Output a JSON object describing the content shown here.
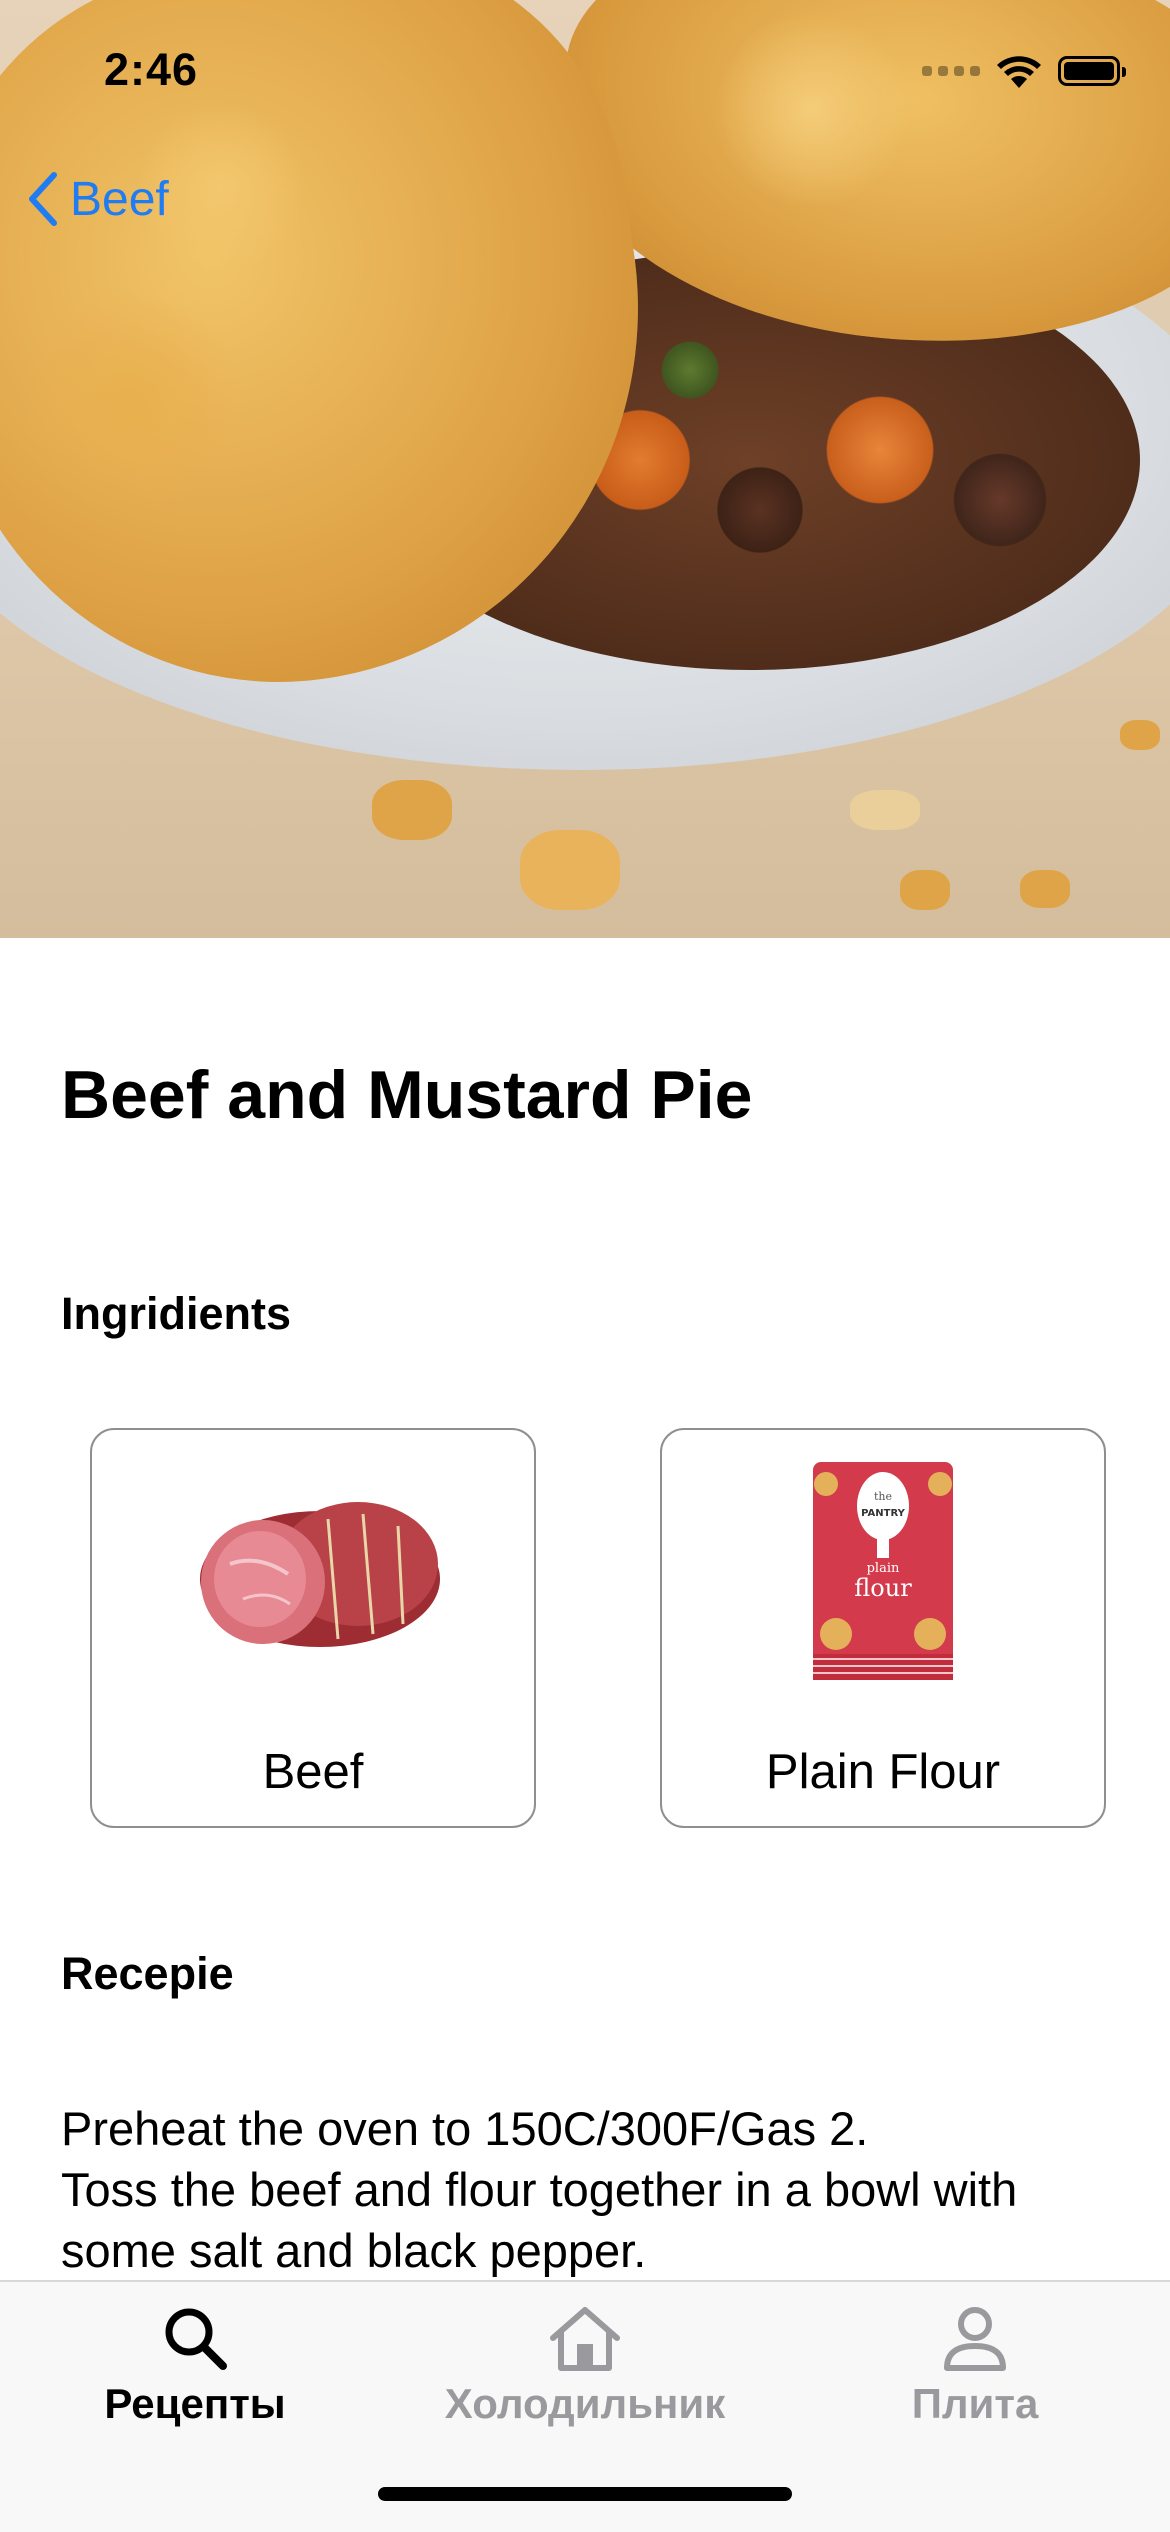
{
  "status_bar": {
    "time": "2:46"
  },
  "nav": {
    "back_label": "Beef"
  },
  "recipe": {
    "title": "Beef and Mustard Pie",
    "ingredients_heading": "Ingridients",
    "ingredients": [
      {
        "name": "Beef"
      },
      {
        "name": "Plain Flour"
      }
    ],
    "flour_pack_text": {
      "brand_line1": "the",
      "brand_line2": "PANTRY",
      "product_line1": "plain",
      "product_line2": "flour"
    },
    "recipe_heading": "Recepie",
    "recipe_text": "Preheat the oven to 150C/300F/Gas 2.\nToss the beef and flour together in a bowl with some salt and black pepper."
  },
  "tab_bar": {
    "tabs": [
      {
        "label": "Рецепты",
        "icon": "search-icon",
        "active": true
      },
      {
        "label": "Холодильник",
        "icon": "house-icon",
        "active": false
      },
      {
        "label": "Плита",
        "icon": "person-icon",
        "active": false
      }
    ]
  },
  "colors": {
    "accent": "#1f7cf2",
    "inactive_tab": "#9a9a9e",
    "card_border": "#8e8e93"
  }
}
